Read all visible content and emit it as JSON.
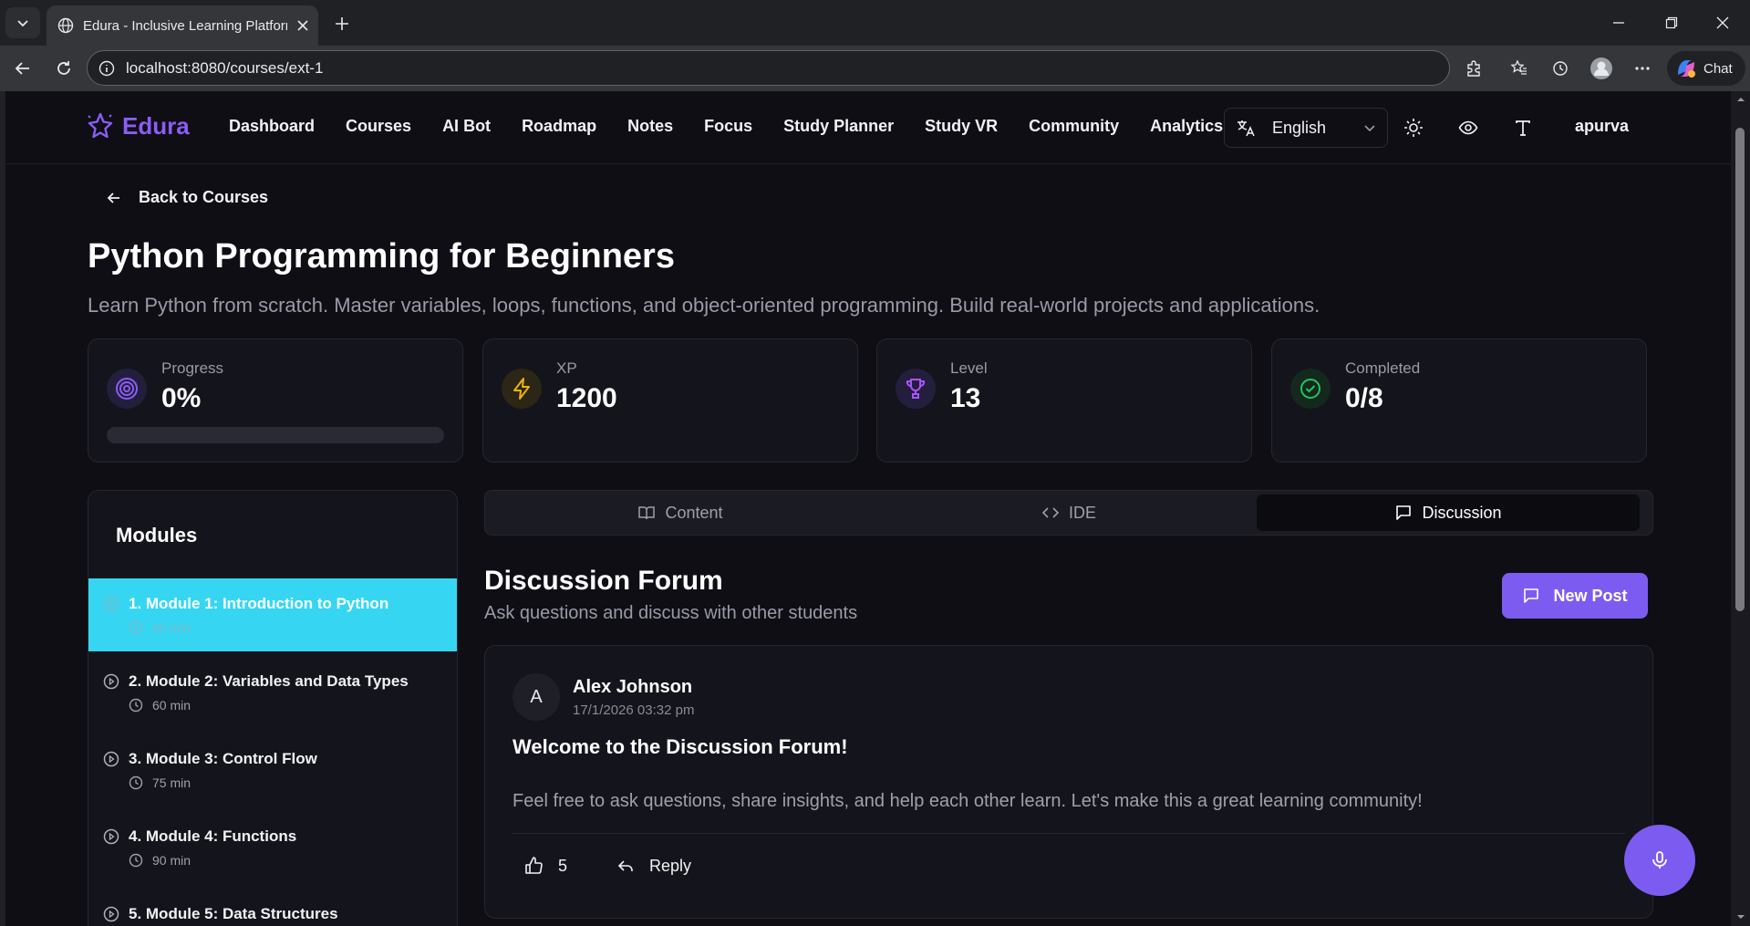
{
  "browser": {
    "tab_title": "Edura - Inclusive Learning Platform",
    "url": "localhost:8080/courses/ext-1",
    "chat_label": "Chat"
  },
  "app": {
    "brand": "Edura",
    "nav": [
      "Dashboard",
      "Courses",
      "AI Bot",
      "Roadmap",
      "Notes",
      "Focus",
      "Study Planner",
      "Study VR",
      "Community",
      "Analytics"
    ],
    "language": "English",
    "user": "apurva",
    "accent_color": "#8b5cf6"
  },
  "course": {
    "back_label": "Back to Courses",
    "title": "Python Programming for Beginners",
    "description": "Learn Python from scratch. Master variables, loops, functions, and object-oriented programming. Build real-world projects and applications."
  },
  "stats": {
    "progress": {
      "label": "Progress",
      "value": "0%",
      "fraction": 0
    },
    "xp": {
      "label": "XP",
      "value": "1200"
    },
    "level": {
      "label": "Level",
      "value": "13"
    },
    "completed": {
      "label": "Completed",
      "value": "0/8"
    }
  },
  "modules": {
    "title": "Modules",
    "items": [
      {
        "name": "1. Module 1: Introduction to Python",
        "duration": "45 min"
      },
      {
        "name": "2. Module 2: Variables and Data Types",
        "duration": "60 min"
      },
      {
        "name": "3. Module 3: Control Flow",
        "duration": "75 min"
      },
      {
        "name": "4. Module 4: Functions",
        "duration": "90 min"
      },
      {
        "name": "5. Module 5: Data Structures",
        "duration": ""
      }
    ]
  },
  "tabs": [
    "Content",
    "IDE",
    "Discussion"
  ],
  "forum": {
    "title": "Discussion Forum",
    "subtitle": "Ask questions and discuss with other students",
    "new_post_label": "New Post",
    "post": {
      "avatar_letter": "A",
      "author": "Alex Johnson",
      "date": "17/1/2026 03:32 pm",
      "title": "Welcome to the Discussion Forum!",
      "body": "Feel free to ask questions, share insights, and help each other learn. Let's make this a great learning community!",
      "likes": "5",
      "reply_label": "Reply"
    }
  }
}
